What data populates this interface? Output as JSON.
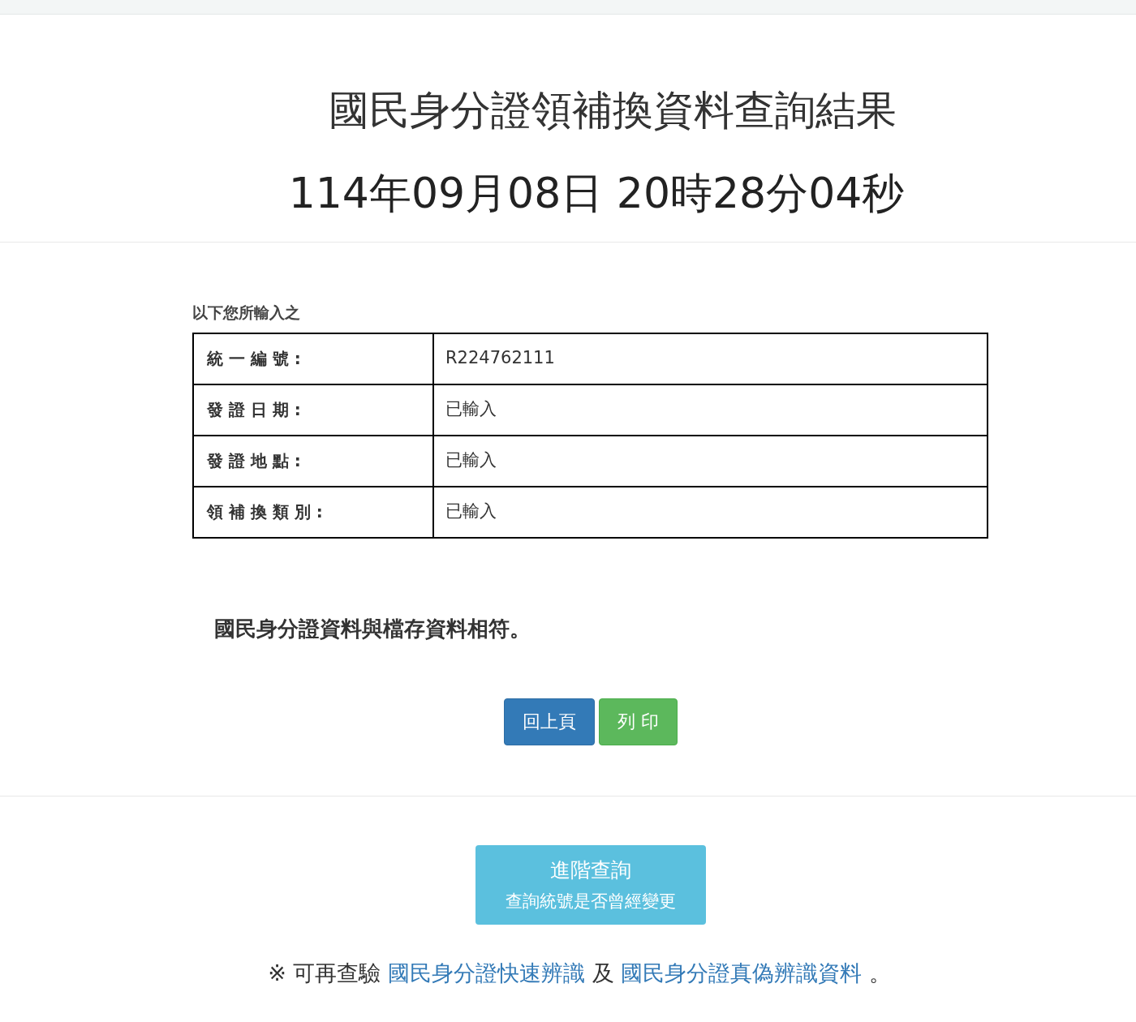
{
  "title": "國民身分證領補換資料查詢結果",
  "timestamp": "114年09月08日 20時28分04秒",
  "input_caption": "以下您所輸入之",
  "table": {
    "rows": [
      {
        "label": "統 一 編 號 :",
        "value": "R224762111"
      },
      {
        "label": "發 證 日 期 :",
        "value": "已輸入"
      },
      {
        "label": "發 證 地 點 :",
        "value": "已輸入"
      },
      {
        "label": "領 補 換 類 別 :",
        "value": "已輸入"
      }
    ]
  },
  "result": "國民身分證資料與檔存資料相符。",
  "buttons": [
    {
      "kind": "back",
      "label": "回上頁"
    },
    {
      "kind": "print",
      "label": "列 印"
    }
  ],
  "advanced_button": {
    "title": "進階查詢",
    "subtitle": "查詢統號是否曾經變更"
  },
  "note": [
    {
      "kind": "text",
      "text": "※ 可再查驗"
    },
    {
      "kind": "link",
      "text": "國民身分證快速辨識"
    },
    {
      "kind": "text",
      "text": "及"
    },
    {
      "kind": "link",
      "text": "國民身分證真偽辨識資料"
    },
    {
      "kind": "text",
      "text": "。"
    }
  ]
}
